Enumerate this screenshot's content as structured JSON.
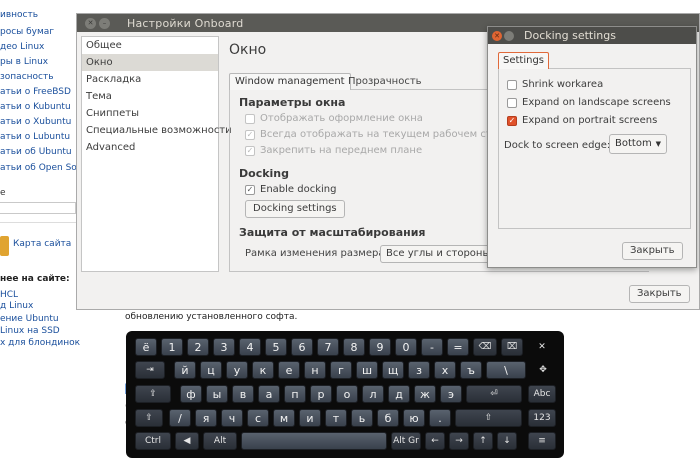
{
  "background_page": {
    "sidebar_links": [
      "ивность",
      "росы бумаг",
      "део Linux",
      "ры в Linux",
      "зопасность",
      "атьи о FreeBSD",
      "атьи о Kubuntu",
      "атьи о Xubuntu",
      "атьи о Lubuntu",
      "атьи об Ubuntu",
      "атьи об Open Source"
    ],
    "search_label": "е",
    "map_label": "Карта сайта",
    "heading": "нее на сайте:",
    "recent_links": [
      "HCL",
      "д Linux",
      "ение Ubuntu",
      "Linux на SSD",
      "х для блондинок"
    ],
    "content_text": "обновлению установленного софта.",
    "fragments": [
      "П",
      "Н",
      "ч",
      "о",
      "П"
    ]
  },
  "main_window": {
    "title": "Настройки Onboard",
    "categories": [
      "Общее",
      "Окно",
      "Раскладка",
      "Тема",
      "Сниппеты",
      "Специальные возможности",
      "Advanced"
    ],
    "selected_category": "Окно",
    "page_title": "Окно",
    "tabs": [
      "Window management",
      "Прозрачность"
    ],
    "window_params": {
      "heading": "Параметры окна",
      "options": [
        {
          "label": "Отображать оформление окна",
          "checked": false,
          "enabled": false
        },
        {
          "label": "Всегда отображать на текущем рабочем столе",
          "checked": true,
          "enabled": false
        },
        {
          "label": "Закрепить на переднем плане",
          "checked": true,
          "enabled": false
        }
      ]
    },
    "docking": {
      "heading": "Docking",
      "enable_label": "Enable docking",
      "enable_checked": true,
      "settings_button": "Docking settings"
    },
    "scale_protection": {
      "heading": "Защита от масштабирования",
      "frame_label": "Рамка изменения размера:",
      "frame_value": "Все углы и стороны"
    },
    "close_button": "Закрыть"
  },
  "docking_dialog": {
    "title": "Docking settings",
    "tab": "Settings",
    "options": [
      {
        "label": "Shrink workarea",
        "checked": false
      },
      {
        "label": "Expand on landscape screens",
        "checked": false
      },
      {
        "label": "Expand on portrait screens",
        "checked": true
      }
    ],
    "edge_label": "Dock to screen edge:",
    "edge_value": "Bottom",
    "close_button": "Закрыть"
  },
  "keyboard": {
    "rows": [
      [
        "ё",
        "1",
        "2",
        "3",
        "4",
        "5",
        "6",
        "7",
        "8",
        "9",
        "0",
        "-",
        "=",
        "⌫",
        "⌧",
        "✕"
      ],
      [
        "⇥",
        "й",
        "ц",
        "у",
        "к",
        "е",
        "н",
        "г",
        "ш",
        "щ",
        "з",
        "х",
        "ъ",
        "\\",
        "✥"
      ],
      [
        "⇪",
        "ф",
        "ы",
        "в",
        "а",
        "п",
        "р",
        "о",
        "л",
        "д",
        "ж",
        "э",
        "⏎",
        "Abc"
      ],
      [
        "⇧",
        "/",
        "я",
        "ч",
        "с",
        "м",
        "и",
        "т",
        "ь",
        "б",
        "ю",
        ".",
        "⇧",
        "123"
      ],
      [
        "Ctrl",
        "◀",
        "Alt",
        "",
        "Alt Gr",
        "←",
        "→",
        "↑",
        "↓",
        "≡"
      ]
    ]
  },
  "colors": {
    "titlebar": "#5a5a56",
    "accent": "#e0512a",
    "keyboard_bg": "#0b0b0b"
  }
}
